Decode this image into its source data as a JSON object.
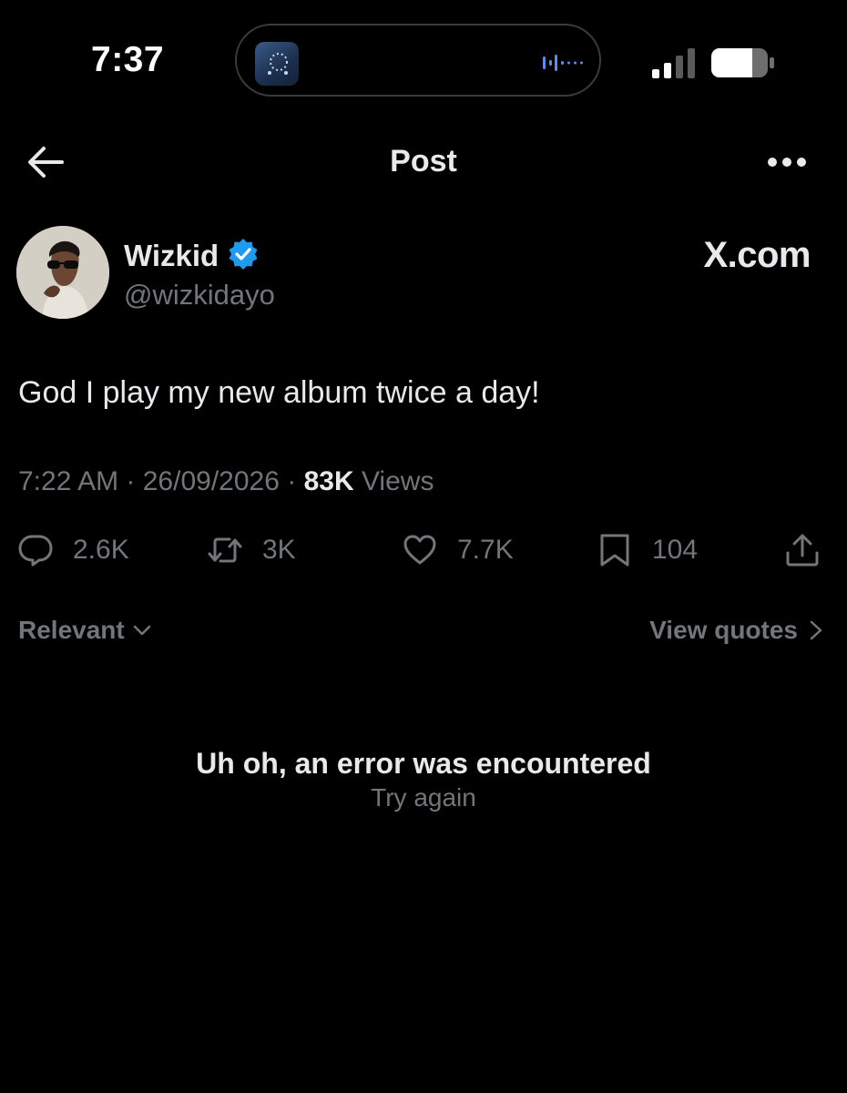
{
  "status_bar": {
    "time": "7:37"
  },
  "header": {
    "title": "Post"
  },
  "author": {
    "name": "Wizkid",
    "handle": "@wizkidayo",
    "verified": true
  },
  "watermark": "X.com",
  "post": {
    "text": "God I play my new album twice a day!",
    "time": "7:22 AM",
    "date": "26/09/2026",
    "views": "83K",
    "views_label": "Views"
  },
  "actions": {
    "replies": "2.6K",
    "reposts": "3K",
    "likes": "7.7K",
    "bookmarks": "104"
  },
  "replies_section": {
    "sort_label": "Relevant",
    "view_quotes_label": "View quotes"
  },
  "error": {
    "title": "Uh oh, an error was encountered",
    "retry_label": "Try again"
  },
  "colors": {
    "background": "#000000",
    "primary_text": "#e7e9ea",
    "secondary_text": "#71767b",
    "verified_badge": "#1d9bf0"
  },
  "icons": {
    "back": "back-arrow-icon",
    "more": "more-horizontal-icon",
    "verified": "verified-badge-icon",
    "reply": "reply-icon",
    "repost": "repost-icon",
    "like": "heart-icon",
    "bookmark": "bookmark-icon",
    "share": "share-icon"
  }
}
